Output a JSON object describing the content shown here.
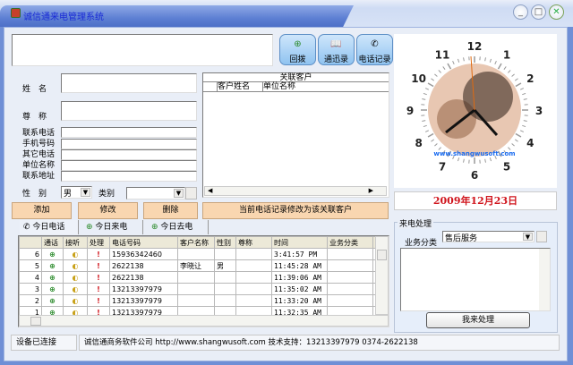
{
  "window": {
    "title": "诚信通来电管理系统",
    "min_label": "_",
    "max_label": "□",
    "close_label": "✕"
  },
  "toolbar": {
    "callback": "回拨",
    "contacts": "通迅录",
    "call_log": "电话记录"
  },
  "form": {
    "name_label": "姓　名",
    "title_label": "尊　称",
    "phone_label": "联系电话",
    "mobile_label": "手机号码",
    "other_phone_label": "其它电话",
    "company_label": "单位名称",
    "address_label": "联系地址",
    "gender_label": "性　别",
    "gender_value": "男",
    "category_label": "类别",
    "category_value": ""
  },
  "related": {
    "title": "关联客户",
    "columns": [
      "客户姓名",
      "单位名称"
    ]
  },
  "actions": {
    "add": "添加",
    "edit": "修改",
    "delete": "删除",
    "assign": "当前电话记录修改为该关联客户"
  },
  "tabs": [
    {
      "label": "今日电话",
      "active": true
    },
    {
      "label": "今日来电"
    },
    {
      "label": "今日去电"
    }
  ],
  "calls": {
    "columns": [
      "",
      "通话",
      "接听",
      "处理",
      "电话号码",
      "客户名称",
      "性别",
      "尊称",
      "时间",
      "业务分类",
      ""
    ],
    "rows": [
      {
        "n": "6",
        "phone": "15936342460",
        "name": "",
        "gender": "",
        "title": "",
        "time": "3:41:57 PM",
        "cat": ""
      },
      {
        "n": "5",
        "phone": "2622138",
        "name": "李晓让",
        "gender": "男",
        "title": "",
        "time": "11:45:28 AM",
        "cat": ""
      },
      {
        "n": "4",
        "phone": "2622138",
        "name": "",
        "gender": "",
        "title": "",
        "time": "11:39:06 AM",
        "cat": ""
      },
      {
        "n": "3",
        "phone": "13213397979",
        "name": "",
        "gender": "",
        "title": "",
        "time": "11:35:02 AM",
        "cat": ""
      },
      {
        "n": "2",
        "phone": "13213397979",
        "name": "",
        "gender": "",
        "title": "",
        "time": "11:33:20 AM",
        "cat": ""
      },
      {
        "n": "1",
        "phone": "13213397979",
        "name": "",
        "gender": "",
        "title": "",
        "time": "11:32:35 AM",
        "cat": ""
      }
    ]
  },
  "clock": {
    "numbers": [
      "12",
      "1",
      "2",
      "3",
      "4",
      "5",
      "6",
      "7",
      "8",
      "9",
      "10",
      "11"
    ],
    "watermark": "www.shangwusoft.com"
  },
  "date": "2009年12月23日",
  "handling": {
    "group_label": "来电处理",
    "category_label": "业务分类",
    "category_value": "售后服务",
    "notes": "",
    "submit": "我来处理"
  },
  "status": {
    "device": "设备已连接",
    "info": "诚信通商务软件公司 http://www.shangwusoft.com 技术支持：13213397979 0374-2622138"
  },
  "colors": {
    "date": "#d0141c",
    "orange_button": "#f9d6b0",
    "title_text": "#1a2bd6"
  }
}
